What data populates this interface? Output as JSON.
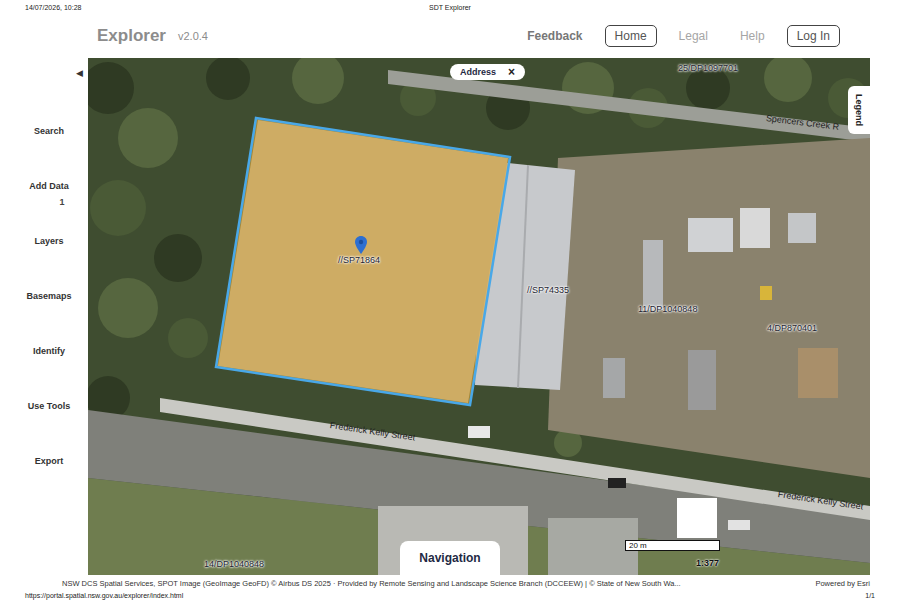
{
  "print_header": {
    "datetime": "14/07/2026, 10:28",
    "title": "SDT Explorer"
  },
  "app": {
    "name": "Explorer",
    "version": "v2.0.4"
  },
  "nav": [
    {
      "label": "Feedback",
      "kind": "link",
      "selected": false
    },
    {
      "label": "Home",
      "kind": "link",
      "selected": true
    },
    {
      "label": "Legal",
      "kind": "link",
      "selected": false
    },
    {
      "label": "Help",
      "kind": "link",
      "selected": false
    },
    {
      "label": "Log In",
      "kind": "button",
      "selected": false
    }
  ],
  "sidebar": {
    "collapse_icon": "◀",
    "items": [
      {
        "label": "Search"
      },
      {
        "label": "Add Data",
        "badge": "1"
      },
      {
        "label": "Layers"
      },
      {
        "label": "Basemaps"
      },
      {
        "label": "Identify"
      },
      {
        "label": "Use Tools"
      },
      {
        "label": "Export"
      }
    ]
  },
  "map": {
    "address_chip": {
      "label": "Address",
      "close": "×"
    },
    "legend_tab": "Legend",
    "labels": [
      {
        "text": "25/DP1097701",
        "kind": "parcel",
        "selected": false
      },
      {
        "text": "Spencers Creek R",
        "kind": "road",
        "selected": false
      },
      {
        "text": "//SP71864",
        "kind": "parcel",
        "selected": true
      },
      {
        "text": "//SP74335",
        "kind": "parcel",
        "selected": false
      },
      {
        "text": "11/DP1040848",
        "kind": "parcel",
        "selected": false
      },
      {
        "text": "4/DP870401",
        "kind": "parcel",
        "selected": false
      },
      {
        "text": "Frederick Kelly Street",
        "kind": "road",
        "selected": false
      },
      {
        "text": "Frederick Kelly Street",
        "kind": "road",
        "selected": false
      },
      {
        "text": "14/DP1040848",
        "kind": "parcel",
        "selected": false
      }
    ],
    "navigation_button": "Navigation",
    "scale": {
      "distance": "20 m",
      "ratio": "1:377"
    }
  },
  "attribution": {
    "text": "NSW DCS Spatial Services, SPOT Image (GeoImage GeoFD) © Airbus DS 2025 · Provided by Remote Sensing and Landscape Science Branch (DCCEEW) | © State of New South Wa...",
    "powered_by": "Powered by Esri"
  },
  "print_footer": {
    "url": "https://portal.spatial.nsw.gov.au/explorer/index.html",
    "page": "1/1"
  }
}
